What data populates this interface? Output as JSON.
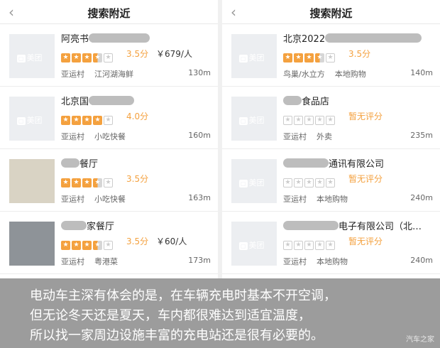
{
  "screens": [
    {
      "title": "搜索附近",
      "items": [
        {
          "name": "阿亮书",
          "stars": [
            "full",
            "full",
            "full",
            "half",
            "empty"
          ],
          "score": "3.5分",
          "price": "￥679/人",
          "area": "亚运村",
          "category": "江河湖海鲜",
          "distance": "130m",
          "thumb": "logo"
        },
        {
          "name": "北京国",
          "stars": [
            "full",
            "full",
            "full",
            "full",
            "empty"
          ],
          "score": "4.0分",
          "price": "",
          "area": "亚运村",
          "category": "小吃快餐",
          "distance": "160m",
          "thumb": "logo"
        },
        {
          "name": "餐厅",
          "stars": [
            "full",
            "full",
            "full",
            "half",
            "empty"
          ],
          "score": "3.5分",
          "price": "",
          "area": "亚运村",
          "category": "小吃快餐",
          "distance": "163m",
          "thumb": "photo"
        },
        {
          "name": "家餐厅",
          "stars": [
            "full",
            "full",
            "full",
            "half",
            "empty"
          ],
          "score": "3.5分",
          "price": "￥60/人",
          "area": "亚运村",
          "category": "粤港菜",
          "distance": "173m",
          "thumb": "street"
        }
      ]
    },
    {
      "title": "搜索附近",
      "items": [
        {
          "name": "北京2022",
          "stars": [
            "full",
            "full",
            "full",
            "half",
            "empty"
          ],
          "score": "3.5分",
          "price": "",
          "area": "鸟巢/水立方",
          "category": "本地购物",
          "distance": "140m",
          "thumb": "logo"
        },
        {
          "name": "食品店",
          "stars": [
            "empty",
            "empty",
            "empty",
            "empty",
            "empty"
          ],
          "score": "暂无评分",
          "price": "",
          "area": "亚运村",
          "category": "外卖",
          "distance": "235m",
          "thumb": "logo"
        },
        {
          "name": "通讯有限公司",
          "stars": [
            "empty",
            "empty",
            "empty",
            "empty",
            "empty"
          ],
          "score": "暂无评分",
          "price": "",
          "area": "亚运村",
          "category": "本地购物",
          "distance": "240m",
          "thumb": "logo"
        },
        {
          "name": "电子有限公司（北…",
          "stars": [
            "empty",
            "empty",
            "empty",
            "empty",
            "empty"
          ],
          "score": "暂无评分",
          "price": "",
          "area": "亚运村",
          "category": "本地购物",
          "distance": "240m",
          "thumb": "logo"
        }
      ]
    }
  ],
  "thumb_logo_text": "美团",
  "back_icon": "chevron-left-icon",
  "caption": {
    "lines": [
      "电动车主深有体会的是，在车辆充电时基本不开空调，",
      "但无论冬天还是夏天，车内都很难达到适宜温度，",
      "所以找一家周边设施丰富的充电站还是很有必要的。"
    ],
    "watermark": "汽车之家"
  },
  "colors": {
    "accent": "#f4a13f",
    "caption_bg": "#9c9c9c"
  }
}
